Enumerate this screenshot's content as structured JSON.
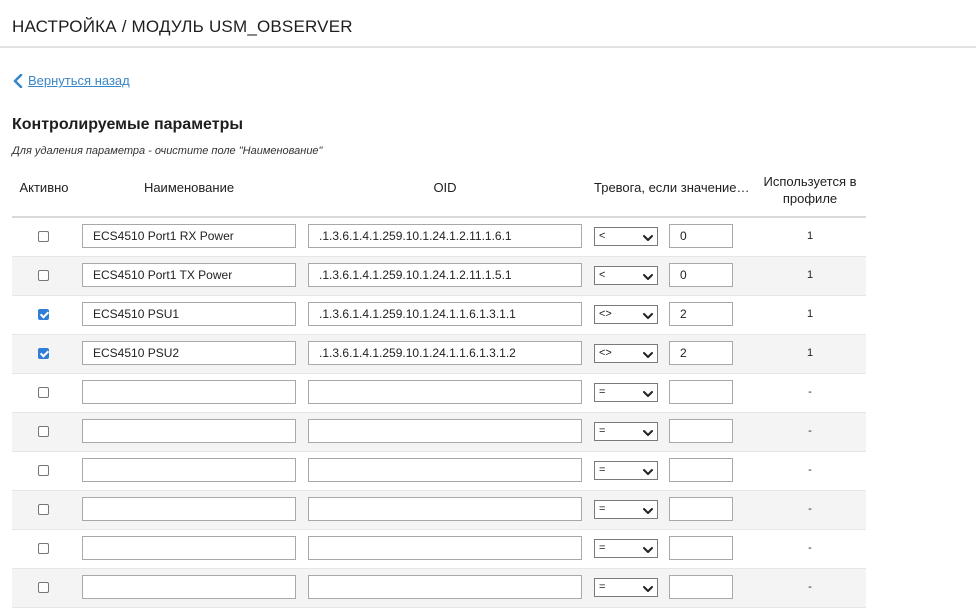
{
  "header": {
    "title": "НАСТРОЙКА / МОДУЛЬ USM_OBSERVER"
  },
  "back_link": {
    "label": "Вернуться назад",
    "icon": "chevron-left-icon",
    "color": "#3a87c8"
  },
  "section": {
    "heading": "Контролируемые параметры",
    "hint": "Для удаления параметра - очистите поле \"Наименование\""
  },
  "table": {
    "columns": {
      "active": "Активно",
      "name": "Наименование",
      "oid": "OID",
      "alarm": "Тревога, если значение…",
      "used": "Используется в профиле"
    },
    "rows": [
      {
        "active": false,
        "name": "ECS4510 Port1 RX Power",
        "oid": ".1.3.6.1.4.1.259.10.1.24.1.2.11.1.6.1",
        "op": "<",
        "value": "0",
        "used": "1"
      },
      {
        "active": false,
        "name": "ECS4510 Port1 TX Power",
        "oid": ".1.3.6.1.4.1.259.10.1.24.1.2.11.1.5.1",
        "op": "<",
        "value": "0",
        "used": "1"
      },
      {
        "active": true,
        "name": "ECS4510 PSU1",
        "oid": ".1.3.6.1.4.1.259.10.1.24.1.1.6.1.3.1.1",
        "op": "<>",
        "value": "2",
        "used": "1"
      },
      {
        "active": true,
        "name": "ECS4510 PSU2",
        "oid": ".1.3.6.1.4.1.259.10.1.24.1.1.6.1.3.1.2",
        "op": "<>",
        "value": "2",
        "used": "1"
      },
      {
        "active": false,
        "name": "",
        "oid": "",
        "op": "=",
        "value": "",
        "used": "-"
      },
      {
        "active": false,
        "name": "",
        "oid": "",
        "op": "=",
        "value": "",
        "used": "-"
      },
      {
        "active": false,
        "name": "",
        "oid": "",
        "op": "=",
        "value": "",
        "used": "-"
      },
      {
        "active": false,
        "name": "",
        "oid": "",
        "op": "=",
        "value": "",
        "used": "-"
      },
      {
        "active": false,
        "name": "",
        "oid": "",
        "op": "=",
        "value": "",
        "used": "-"
      },
      {
        "active": false,
        "name": "",
        "oid": "",
        "op": "=",
        "value": "",
        "used": "-"
      }
    ]
  },
  "colors": {
    "checkbox_checked": "#2f7ed8",
    "row_alt": "#f4f4f4"
  }
}
